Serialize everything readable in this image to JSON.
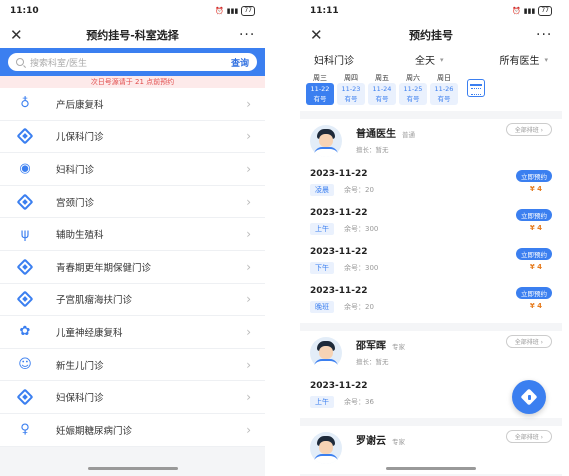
{
  "left": {
    "status_time": "11:10",
    "battery": "77",
    "nav": {
      "close": "✕",
      "title": "预约挂号-科室选择",
      "more": "···"
    },
    "search": {
      "placeholder": "搜索科室/医生",
      "button": "查询"
    },
    "notice": "次日号源请于 21 点前预约",
    "departments": [
      {
        "label": "产后康复科",
        "icon": "mother-baby-icon"
      },
      {
        "label": "儿保科门诊",
        "icon": "diamond-icon"
      },
      {
        "label": "妇科门诊",
        "icon": "gynecology-icon"
      },
      {
        "label": "宫颈门诊",
        "icon": "diamond-icon"
      },
      {
        "label": "辅助生殖科",
        "icon": "uterus-icon"
      },
      {
        "label": "青春期更年期保健门诊",
        "icon": "diamond-icon"
      },
      {
        "label": "子宫肌瘤海扶门诊",
        "icon": "diamond-icon"
      },
      {
        "label": "儿童神经康复科",
        "icon": "brain-icon"
      },
      {
        "label": "新生儿门诊",
        "icon": "baby-icon"
      },
      {
        "label": "妇保科门诊",
        "icon": "diamond-icon"
      },
      {
        "label": "妊娠期糖尿病门诊",
        "icon": "pregnancy-icon"
      }
    ]
  },
  "right": {
    "status_time": "11:11",
    "battery": "77",
    "nav": {
      "close": "✕",
      "title": "预约挂号",
      "more": "···"
    },
    "filters": [
      {
        "label": "妇科门诊",
        "caret": ""
      },
      {
        "label": "全天",
        "caret": "▾"
      },
      {
        "label": "所有医生",
        "caret": "▾"
      }
    ],
    "dates": [
      {
        "week": "周三",
        "date": "11-22",
        "status": "有号",
        "active": true
      },
      {
        "week": "周四",
        "date": "11-23",
        "status": "有号",
        "active": false
      },
      {
        "week": "周五",
        "date": "11-24",
        "status": "有号",
        "active": false
      },
      {
        "week": "周六",
        "date": "11-25",
        "status": "有号",
        "active": false
      },
      {
        "week": "周日",
        "date": "11-26",
        "status": "有号",
        "active": false
      }
    ],
    "doctors": [
      {
        "name": "普通医生",
        "title": "普通",
        "specialty": "擅长：暂无",
        "all_button": "全部排班 ›",
        "slots": [
          {
            "date": "2023-11-22",
            "period": "凌晨",
            "remain": "余号：20",
            "book": "立即预约",
            "price": "¥ 4"
          },
          {
            "date": "2023-11-22",
            "period": "上午",
            "remain": "余号：300",
            "book": "立即预约",
            "price": "¥ 4"
          },
          {
            "date": "2023-11-22",
            "period": "下午",
            "remain": "余号：300",
            "book": "立即预约",
            "price": "¥ 4"
          },
          {
            "date": "2023-11-22",
            "period": "晚班",
            "remain": "余号：20",
            "book": "立即预约",
            "price": "¥ 4"
          }
        ]
      },
      {
        "name": "邵军晖",
        "title": "专家",
        "specialty": "擅长：暂无",
        "all_button": "全部排班 ›",
        "slots": [
          {
            "date": "2023-11-22",
            "period": "上午",
            "remain": "余号：36",
            "book": "",
            "price": ""
          }
        ]
      },
      {
        "name": "罗谢云",
        "title": "专家",
        "specialty": "",
        "all_button": "全部排班 ›",
        "slots": []
      }
    ]
  }
}
